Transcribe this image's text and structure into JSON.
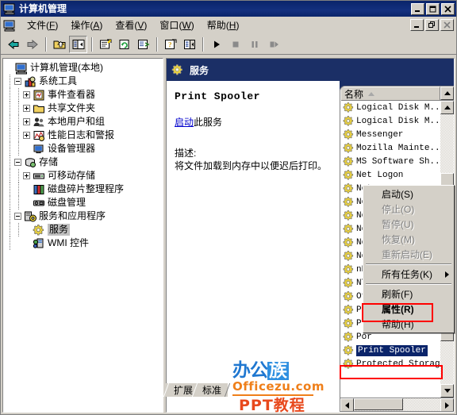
{
  "window": {
    "title": "计算机管理",
    "icon": "computer-icon",
    "controls": [
      "minimize",
      "maximize",
      "close"
    ],
    "child_controls": [
      "minimize",
      "restore",
      "close"
    ]
  },
  "menubar": {
    "icon": "computer-icon",
    "items": [
      {
        "label": "文件",
        "accel": "F"
      },
      {
        "label": "操作",
        "accel": "A"
      },
      {
        "label": "查看",
        "accel": "V"
      },
      {
        "label": "窗口",
        "accel": "W"
      },
      {
        "label": "帮助",
        "accel": "H"
      }
    ]
  },
  "toolbar": {
    "buttons": [
      {
        "name": "back-icon"
      },
      {
        "name": "forward-icon"
      },
      {
        "name": "up-folder-icon"
      },
      {
        "name": "show-tree-icon",
        "pressed": true
      },
      {
        "name": "properties-icon"
      },
      {
        "name": "refresh-icon"
      },
      {
        "name": "export-list-icon"
      },
      {
        "name": "help-icon"
      },
      {
        "name": "show-details-icon"
      },
      {
        "name": "start-service-icon"
      },
      {
        "name": "stop-service-icon"
      },
      {
        "name": "pause-service-icon"
      },
      {
        "name": "restart-service-icon"
      }
    ]
  },
  "tree": {
    "root": {
      "label": "计算机管理(本地)",
      "icon": "computer-icon"
    },
    "nodes": [
      {
        "label": "系统工具",
        "icon": "system-tools-icon",
        "level": 1,
        "expander": "minus"
      },
      {
        "label": "事件查看器",
        "icon": "event-viewer-icon",
        "level": 2,
        "expander": "plus"
      },
      {
        "label": "共享文件夹",
        "icon": "shared-folders-icon",
        "level": 2,
        "expander": "plus"
      },
      {
        "label": "本地用户和组",
        "icon": "local-users-icon",
        "level": 2,
        "expander": "plus"
      },
      {
        "label": "性能日志和警报",
        "icon": "performance-logs-icon",
        "level": 2,
        "expander": "plus"
      },
      {
        "label": "设备管理器",
        "icon": "device-manager-icon",
        "level": 2,
        "expander": "none"
      },
      {
        "label": "存储",
        "icon": "storage-icon",
        "level": 1,
        "expander": "minus"
      },
      {
        "label": "可移动存储",
        "icon": "removable-storage-icon",
        "level": 2,
        "expander": "plus"
      },
      {
        "label": "磁盘碎片整理程序",
        "icon": "defragmenter-icon",
        "level": 2,
        "expander": "none"
      },
      {
        "label": "磁盘管理",
        "icon": "disk-management-icon",
        "level": 2,
        "expander": "none"
      },
      {
        "label": "服务和应用程序",
        "icon": "services-apps-icon",
        "level": 1,
        "expander": "minus"
      },
      {
        "label": "服务",
        "icon": "service-gear-icon",
        "level": 2,
        "expander": "none",
        "selected": true
      },
      {
        "label": "WMI 控件",
        "icon": "wmi-control-icon",
        "level": 2,
        "expander": "none"
      }
    ]
  },
  "right_panel": {
    "header": {
      "title": "服务",
      "icon": "service-gear-icon"
    },
    "detail": {
      "service_name": "Print Spooler",
      "action_link": "启动",
      "action_suffix": "此服务",
      "description_label": "描述:",
      "description_text": "将文件加载到内存中以便迟后打印。"
    },
    "list": {
      "column_header": "名称",
      "sort_order": "ascending",
      "items": [
        {
          "name": "Logical Disk M...",
          "icon": "service-gear-icon"
        },
        {
          "name": "Logical Disk M...",
          "icon": "service-gear-icon"
        },
        {
          "name": "Messenger",
          "icon": "service-gear-icon"
        },
        {
          "name": "Mozilla Mainte...",
          "icon": "service-gear-icon"
        },
        {
          "name": "MS Software Sh...",
          "icon": "service-gear-icon"
        },
        {
          "name": "Net Logon",
          "icon": "service-gear-icon"
        },
        {
          "name": "Net",
          "icon": "service-gear-icon"
        },
        {
          "name": "Net",
          "icon": "service-gear-icon"
        },
        {
          "name": "Net",
          "icon": "service-gear-icon"
        },
        {
          "name": "Net",
          "icon": "service-gear-icon"
        },
        {
          "name": "Net",
          "icon": "service-gear-icon"
        },
        {
          "name": "Net",
          "icon": "service-gear-icon"
        },
        {
          "name": "nPr",
          "icon": "service-gear-icon"
        },
        {
          "name": "NT",
          "icon": "service-gear-icon"
        },
        {
          "name": "Off",
          "icon": "service-gear-icon"
        },
        {
          "name": "Per",
          "icon": "service-gear-icon"
        },
        {
          "name": "Plu",
          "icon": "service-gear-icon"
        },
        {
          "name": "Por",
          "icon": "service-gear-icon"
        },
        {
          "name": "Print Spooler",
          "icon": "service-gear-icon",
          "selected": true
        },
        {
          "name": "Protected Storage",
          "icon": "service-gear-icon"
        }
      ]
    }
  },
  "context_menu": {
    "items": [
      {
        "label": "启动(S)",
        "disabled": false,
        "bold": false,
        "submenu": false
      },
      {
        "label": "停止(O)",
        "disabled": true,
        "bold": false,
        "submenu": false
      },
      {
        "label": "暂停(U)",
        "disabled": true,
        "bold": false,
        "submenu": false
      },
      {
        "label": "恢复(M)",
        "disabled": true,
        "bold": false,
        "submenu": false
      },
      {
        "label": "重新启动(E)",
        "disabled": true,
        "bold": false,
        "submenu": false
      },
      {
        "separator": true
      },
      {
        "label": "所有任务(K)",
        "disabled": false,
        "bold": false,
        "submenu": true
      },
      {
        "separator": true
      },
      {
        "label": "刷新(F)",
        "disabled": false,
        "bold": false,
        "submenu": false
      },
      {
        "label": "属性(R)",
        "disabled": false,
        "bold": true,
        "submenu": false,
        "highlighted": true
      },
      {
        "label": "帮助(H)",
        "disabled": false,
        "bold": false,
        "submenu": false
      }
    ]
  },
  "tabs": [
    {
      "label": "扩展",
      "active": true
    },
    {
      "label": "标准",
      "active": false
    }
  ],
  "watermark": {
    "brand_part1": "办公",
    "brand_part2": "族",
    "site": "Officezu.com",
    "tagline": "PPT教程"
  },
  "colors": {
    "title_bar": "#0a246a",
    "panel_header": "#1b2f66",
    "window_face": "#d4d0c8",
    "selection": "#0a246a",
    "annotation": "#ff0000",
    "link": "#0000cc",
    "watermark_blue": "#1f77d0",
    "watermark_orange": "#ef7f1a",
    "watermark_red": "#e8491d"
  }
}
